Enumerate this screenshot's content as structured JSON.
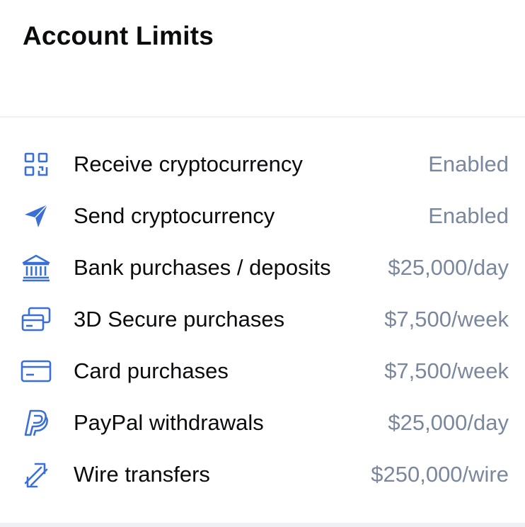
{
  "header": {
    "title": "Account Limits"
  },
  "colors": {
    "icon_blue": "#3a6fd8",
    "value_gray": "#7a879c",
    "label_dark": "#0a0b0d",
    "divider": "#eef0f3"
  },
  "limits": [
    {
      "icon": "qr-code-icon",
      "label": "Receive cryptocurrency",
      "value": "Enabled"
    },
    {
      "icon": "send-icon",
      "label": "Send cryptocurrency",
      "value": "Enabled"
    },
    {
      "icon": "bank-icon",
      "label": "Bank purchases / deposits",
      "value": "$25,000/day"
    },
    {
      "icon": "cards-icon",
      "label": "3D Secure purchases",
      "value": "$7,500/week"
    },
    {
      "icon": "card-icon",
      "label": "Card purchases",
      "value": "$7,500/week"
    },
    {
      "icon": "paypal-icon",
      "label": "PayPal withdrawals",
      "value": "$25,000/day"
    },
    {
      "icon": "transfer-arrows-icon",
      "label": "Wire transfers",
      "value": "$250,000/wire"
    }
  ]
}
